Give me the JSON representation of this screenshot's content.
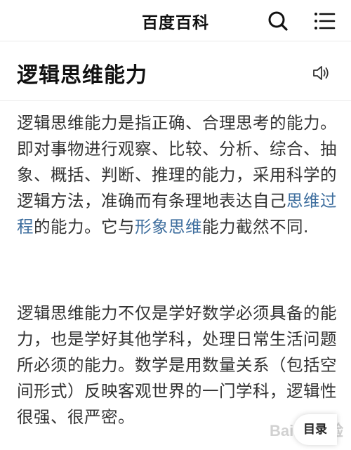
{
  "header": {
    "brand": "百度百科",
    "search_icon": "search-icon",
    "menu_icon": "menu-icon"
  },
  "article": {
    "title": "逻辑思维能力",
    "audio_icon": "speaker-icon",
    "paragraph1": {
      "text_a": "逻辑思维能力是指正确、合理思考的能力。即对事物进行观察、比较、分析、综合、抽象、概括、判断、推理的能力，采用科学的逻辑方法，准确而有条理地表达自己",
      "link_a": "思维过程",
      "text_b": "的能力。它与",
      "link_b": "形象思维",
      "text_c": "能力截然不同."
    },
    "paragraph2": "逻辑思维能力不仅是学好数学必须具备的能力，也是学好其他学科，处理日常生活问题所必须的能力。数学是用数量关系（包括空间形式）反映客观世界的一门学科，逻辑性很强、很严密。"
  },
  "toc": {
    "label": "目录"
  },
  "watermark": {
    "label": "Baidu经验"
  },
  "colors": {
    "link": "#3e6e9e",
    "text": "#333333",
    "title": "#111111"
  }
}
